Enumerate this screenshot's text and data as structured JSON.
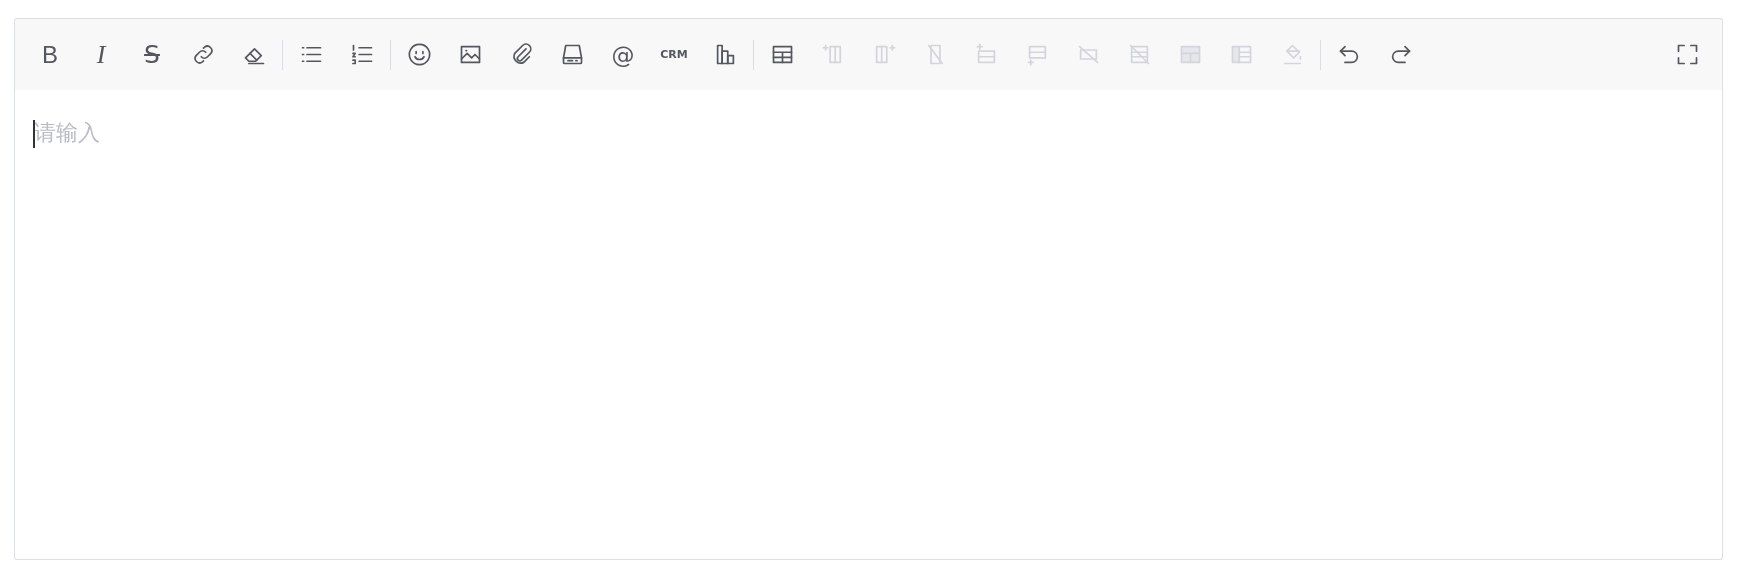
{
  "editor": {
    "toolbar": {
      "groups": [
        {
          "buttons": [
            {
              "label": "B",
              "disabled": false
            },
            {
              "label": "I",
              "disabled": false
            },
            {
              "label": "S",
              "disabled": false
            },
            {
              "disabled": false
            },
            {
              "disabled": false
            }
          ]
        },
        {
          "buttons": [
            {
              "disabled": false
            },
            {
              "disabled": false
            }
          ]
        },
        {
          "buttons": [
            {
              "disabled": false
            },
            {
              "disabled": false
            },
            {
              "disabled": false
            },
            {
              "disabled": false
            },
            {
              "label": "@",
              "disabled": false
            },
            {
              "label": "CRM",
              "disabled": false
            },
            {
              "disabled": false
            }
          ]
        },
        {
          "buttons": [
            {
              "disabled": false
            },
            {
              "disabled": true
            },
            {
              "disabled": true
            },
            {
              "disabled": true
            },
            {
              "disabled": true
            },
            {
              "disabled": true
            },
            {
              "disabled": true
            },
            {
              "disabled": true
            },
            {
              "disabled": true
            },
            {
              "disabled": true
            },
            {
              "disabled": true
            }
          ]
        },
        {
          "buttons": [
            {
              "disabled": false
            },
            {
              "disabled": false
            }
          ]
        }
      ],
      "fullscreen": {
        "disabled": false
      }
    },
    "body": {
      "placeholder": "请输入"
    }
  }
}
